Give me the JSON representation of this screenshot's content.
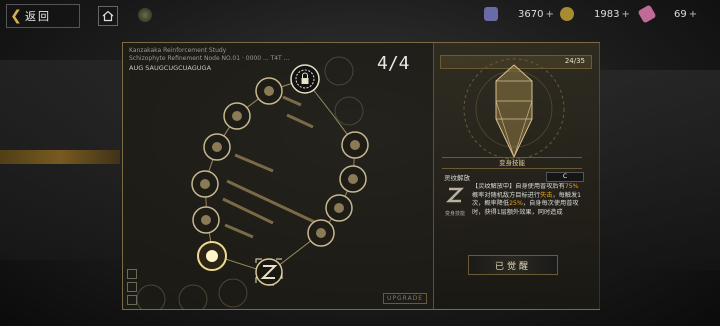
{
  "topbar": {
    "back_label": "返回",
    "resources": [
      {
        "icon": "crystal-icon",
        "value": "3670",
        "color": "#7a7ab8"
      },
      {
        "icon": "coin-icon",
        "value": "1983",
        "color": "#b89a40"
      },
      {
        "icon": "ticket-icon",
        "value": "69",
        "color": "#c87aa8"
      }
    ]
  },
  "tree": {
    "header_line1": "Kanzakaka Reinforcement Study",
    "header_line2": "Schizophyte Refinement Node NO.01 · 0000 ... T4T ...",
    "header_line3": "AUG  SAUGCUGCUAGUGA",
    "counter": "4/4",
    "upgrade_label": "UPGRADE"
  },
  "detail": {
    "progress": "24/35",
    "progress_fraction": 0.686,
    "section_title": "变身技能",
    "skill_name": "灵纹解放",
    "skill_grade": "C",
    "skill_icon_caption": "变身技能",
    "desc_part1": "【灵纹解放中】自身使用普攻后有",
    "desc_hl1": "75%",
    "desc_part2": "概率对随机敌方目标进行",
    "desc_hl2": "失击",
    "desc_part3": "，每触发1次，概率降低",
    "desc_hl3": "25%",
    "desc_part4": "，自身每次使用普攻时，获得1层额外效果，同时造成",
    "awaken_label": "已觉醒"
  },
  "colors": {
    "accent": "#d8b050",
    "highlight": "#e8a020",
    "border": "#7a6a45"
  }
}
